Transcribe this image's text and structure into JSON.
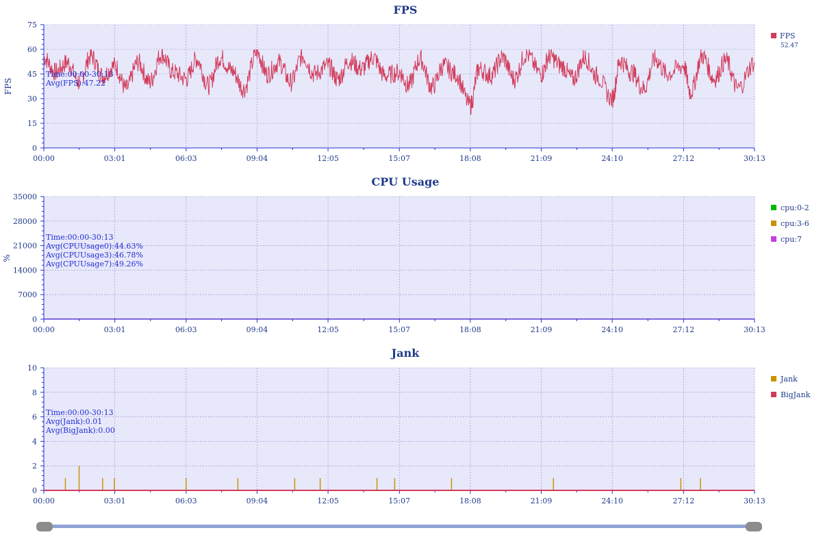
{
  "x_ticks": [
    "00:00",
    "03:01",
    "06:03",
    "09:04",
    "12:05",
    "15:07",
    "18:08",
    "21:09",
    "24:10",
    "27:12",
    "30:13"
  ],
  "colors": {
    "plot_bg": "#e8e8fb",
    "axis": "#1f2fd0",
    "fps": "#d23b5a",
    "cpu02": "#00bb00",
    "cpu36": "#c79400",
    "cpu7": "#c040e0",
    "jank": "#c79400",
    "bigjank": "#d23b5a"
  },
  "chart_data": [
    {
      "type": "line",
      "title": "FPS",
      "ylabel": "FPS",
      "ylim": [
        0,
        75
      ],
      "y_ticks": [
        "0",
        "15",
        "30",
        "45",
        "60",
        "75"
      ],
      "grid": true,
      "legend_position": "right",
      "legend": [
        {
          "name": "FPS",
          "sub": "52.47"
        }
      ],
      "annotations": [
        "Time:00:00-30:13",
        "Avg(FPS):47.22"
      ],
      "series": [
        {
          "name": "FPS",
          "x": [
            "00:00",
            "00:30",
            "01:00",
            "01:30",
            "02:00",
            "02:30",
            "03:01",
            "03:30",
            "04:00",
            "04:30",
            "05:00",
            "05:30",
            "06:03",
            "06:30",
            "07:00",
            "07:30",
            "08:00",
            "08:30",
            "09:04",
            "09:30",
            "10:00",
            "10:30",
            "11:00",
            "11:30",
            "12:05",
            "12:30",
            "13:00",
            "13:30",
            "14:00",
            "14:30",
            "15:07",
            "15:30",
            "16:00",
            "16:30",
            "17:00",
            "17:30",
            "18:08",
            "18:30",
            "19:00",
            "19:30",
            "20:00",
            "20:30",
            "21:09",
            "21:30",
            "22:00",
            "22:30",
            "23:00",
            "23:30",
            "24:10",
            "24:30",
            "25:00",
            "25:30",
            "26:00",
            "26:30",
            "27:12",
            "27:30",
            "28:00",
            "28:30",
            "29:00",
            "29:30",
            "30:13"
          ],
          "values": [
            55,
            46,
            52,
            40,
            56,
            44,
            50,
            36,
            52,
            40,
            57,
            46,
            42,
            54,
            38,
            55,
            47,
            36,
            58,
            45,
            52,
            40,
            56,
            45,
            50,
            42,
            53,
            48,
            55,
            44,
            46,
            38,
            54,
            37,
            50,
            45,
            26,
            48,
            44,
            55,
            42,
            57,
            45,
            56,
            50,
            42,
            55,
            44,
            30,
            53,
            46,
            36,
            54,
            45,
            50,
            34,
            56,
            42,
            53,
            36,
            52
          ]
        }
      ]
    },
    {
      "type": "line",
      "title": "CPU Usage",
      "ylabel": "%",
      "ylim": [
        0,
        35000
      ],
      "y_ticks": [
        "0",
        "7000",
        "14000",
        "21000",
        "28000",
        "35000"
      ],
      "grid": true,
      "legend_position": "right",
      "legend": [
        {
          "name": "cpu:0-2"
        },
        {
          "name": "cpu:3-6"
        },
        {
          "name": "cpu:7"
        }
      ],
      "annotations": [
        "Time:00:00-30:13",
        "Avg(CPUUsage0):44.63%",
        "Avg(CPUUsage3):46.78%",
        "Avg(CPUUsage7):49.26%"
      ],
      "series": [
        {
          "name": "cpu:0-2",
          "values": [
            44.6,
            44.6
          ]
        },
        {
          "name": "cpu:3-6",
          "values": [
            46.8,
            46.8
          ]
        },
        {
          "name": "cpu:7",
          "values": [
            49.3,
            49.3
          ]
        }
      ]
    },
    {
      "type": "line",
      "title": "Jank",
      "ylim": [
        0,
        10
      ],
      "y_ticks": [
        "0",
        "2",
        "4",
        "6",
        "8",
        "10"
      ],
      "grid": true,
      "legend_position": "right",
      "legend": [
        {
          "name": "Jank"
        },
        {
          "name": "BigJank"
        }
      ],
      "annotations": [
        "Time:00:00-30:13",
        "Avg(Jank):0.01",
        "Avg(BigJank):0.00"
      ],
      "series": [
        {
          "name": "Jank",
          "spikes_x": [
            "00:55",
            "01:30",
            "02:30",
            "03:00",
            "06:03",
            "08:15",
            "10:40",
            "11:45",
            "14:10",
            "14:55",
            "17:20",
            "21:40",
            "27:05",
            "27:55"
          ],
          "spikes_y": [
            1,
            2,
            1,
            1,
            1,
            1,
            1,
            1,
            1,
            1,
            1,
            1,
            1,
            1
          ]
        },
        {
          "name": "BigJank",
          "spikes_x": [],
          "spikes_y": []
        }
      ]
    }
  ]
}
